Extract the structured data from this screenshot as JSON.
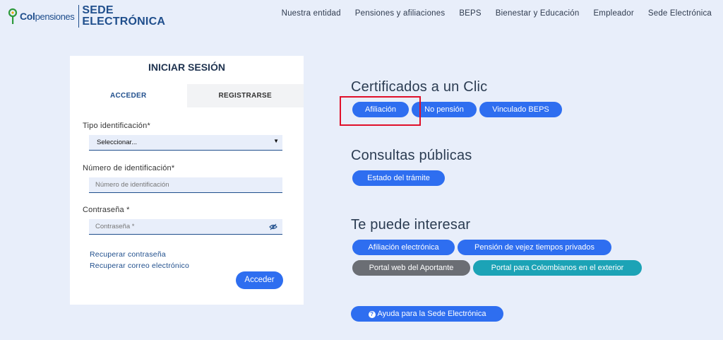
{
  "header": {
    "logo": {
      "col": "Col",
      "pensiones": "pensiones",
      "sede_line1": "SEDE",
      "sede_line2": "ELECTRÓNICA"
    },
    "nav": [
      "Nuestra entidad",
      "Pensiones y afiliaciones",
      "BEPS",
      "Bienestar y Educación",
      "Empleador",
      "Sede Electrónica"
    ]
  },
  "login": {
    "title": "INICIAR SESIÓN",
    "tabs": [
      "ACCEDER",
      "REGISTRARSE"
    ],
    "active_tab": "ACCEDER",
    "tipo_label": "Tipo identificación*",
    "tipo_value": "Seleccionar...",
    "numero_label": "Número de identificación*",
    "numero_placeholder": "Número de identificación",
    "password_label": "Contraseña *",
    "password_placeholder": "Contraseña *",
    "recover_password": "Recuperar contraseña",
    "recover_email": "Recuperar correo electrónico",
    "submit": "Acceder"
  },
  "certificados": {
    "title": "Certificados a un Clic",
    "buttons": [
      "Afiliación",
      "No pensión",
      "Vinculado BEPS"
    ]
  },
  "consultas": {
    "title": "Consultas públicas",
    "buttons": [
      "Estado del trámite"
    ]
  },
  "interesar": {
    "title": "Te puede interesar",
    "buttons": [
      "Afiliación electrónica",
      "Pensión de vejez tiempos privados",
      "Portal web del Aportante",
      "Portal para Colombianos en el exterior"
    ]
  },
  "help": {
    "label": "Ayuda para la Sede Electrónica",
    "icon": "?"
  },
  "colors": {
    "primary": "#2e6ef0",
    "gray": "#6b6e74",
    "teal": "#1ca3b6",
    "highlight": "#e0102a",
    "background": "#e8eefa"
  }
}
